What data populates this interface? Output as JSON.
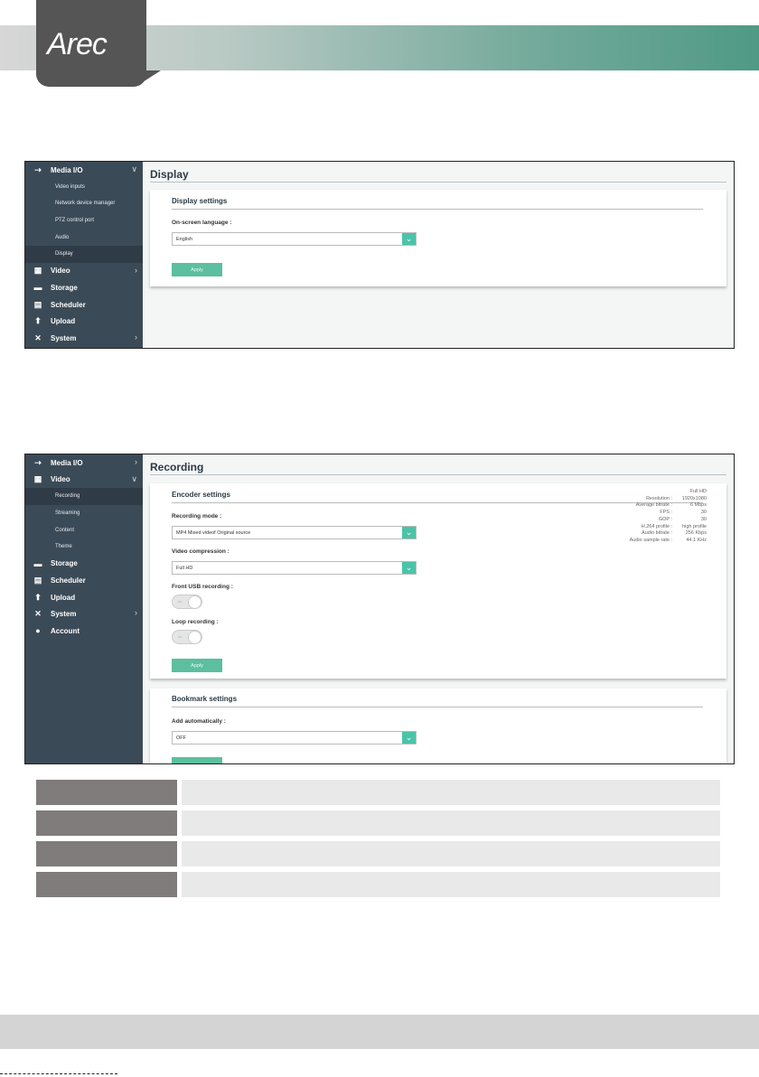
{
  "brand": {
    "logo": "Arec"
  },
  "shot1": {
    "sidebar": [
      {
        "icon": "media-io-icon",
        "glyph": "⇢",
        "label": "Media I/O",
        "chev": "∨",
        "subs": [
          "Video inputs",
          "Network device manager",
          "PTZ control port",
          "Audio",
          "Display"
        ],
        "active": 4
      },
      {
        "icon": "video-icon",
        "glyph": "▦",
        "label": "Video",
        "chev": "›"
      },
      {
        "icon": "storage-icon",
        "glyph": "▬",
        "label": "Storage"
      },
      {
        "icon": "scheduler-icon",
        "glyph": "▤",
        "label": "Scheduler"
      },
      {
        "icon": "upload-icon",
        "glyph": "⬆",
        "label": "Upload"
      },
      {
        "icon": "system-icon",
        "glyph": "✕",
        "label": "System",
        "chev": "›"
      }
    ],
    "title": "Display",
    "card_title": "Display settings",
    "field_label": "On-screen language :",
    "field_value": "English",
    "apply": "Apply"
  },
  "shot2": {
    "sidebar": [
      {
        "icon": "media-io-icon",
        "glyph": "⇢",
        "label": "Media I/O",
        "chev": "›"
      },
      {
        "icon": "video-icon",
        "glyph": "▦",
        "label": "Video",
        "chev": "∨",
        "subs": [
          "Recording",
          "Streaming",
          "Content",
          "Theme"
        ],
        "active": 0
      },
      {
        "icon": "storage-icon",
        "glyph": "▬",
        "label": "Storage"
      },
      {
        "icon": "scheduler-icon",
        "glyph": "▤",
        "label": "Scheduler"
      },
      {
        "icon": "upload-icon",
        "glyph": "⬆",
        "label": "Upload"
      },
      {
        "icon": "system-icon",
        "glyph": "✕",
        "label": "System",
        "chev": "›"
      },
      {
        "icon": "account-icon",
        "glyph": "●",
        "label": "Account"
      }
    ],
    "title": "Recording",
    "encoder": {
      "card_title": "Encoder settings",
      "recording_mode_label": "Recording mode :",
      "recording_mode_value": "MP4 Mixed videof Original source",
      "compression_label": "Video compression :",
      "compression_value": "Full HD",
      "front_usb_label": "Front USB recording :",
      "loop_label": "Loop recording :",
      "toggle_on": "on",
      "apply": "Apply",
      "info_heading": "Full HD",
      "info": [
        {
          "k": "Resolution :",
          "v": "1920x1080"
        },
        {
          "k": "Average bitrate :",
          "v": "6 Mbps"
        },
        {
          "k": "FPS :",
          "v": "30"
        },
        {
          "k": "GOP :",
          "v": "30"
        },
        {
          "k": "H.264 profile :",
          "v": "high profile"
        },
        {
          "k": "Audio bitrate :",
          "v": "256 Kbps"
        },
        {
          "k": "Audio sample rate :",
          "v": "44.1 KHz"
        }
      ]
    },
    "bookmark": {
      "card_title": "Bookmark settings",
      "add_label": "Add automatically :",
      "add_value": "OFF"
    }
  }
}
